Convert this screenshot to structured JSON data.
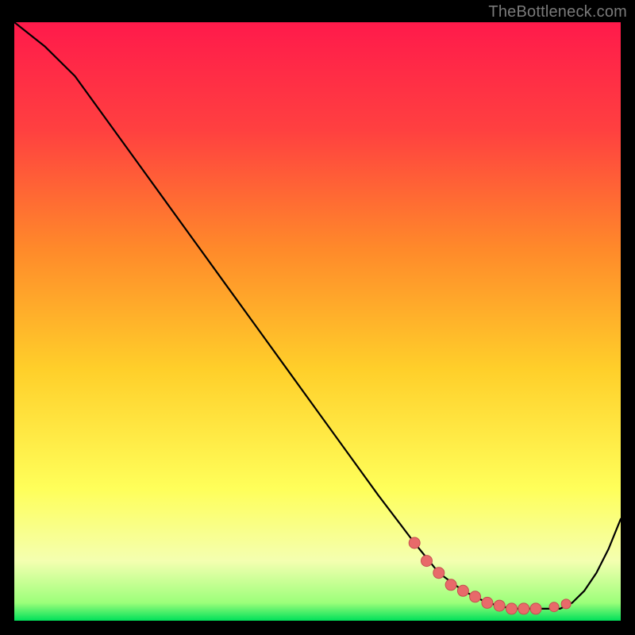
{
  "watermark": "TheBottleneck.com",
  "colors": {
    "bg": "#000000",
    "watermark": "#7a7a7a",
    "line": "#000000",
    "marker_fill": "#e86a6a",
    "marker_stroke": "#c64f50",
    "gradient_stops": [
      {
        "offset": "0%",
        "color": "#ff1a4b"
      },
      {
        "offset": "18%",
        "color": "#ff4040"
      },
      {
        "offset": "38%",
        "color": "#ff8a2a"
      },
      {
        "offset": "58%",
        "color": "#ffcf2a"
      },
      {
        "offset": "78%",
        "color": "#ffff5a"
      },
      {
        "offset": "90%",
        "color": "#f4ffb0"
      },
      {
        "offset": "97%",
        "color": "#9cff7a"
      },
      {
        "offset": "100%",
        "color": "#00e05a"
      }
    ]
  },
  "chart_data": {
    "type": "line",
    "title": "",
    "xlabel": "",
    "ylabel": "",
    "xlim": [
      0,
      100
    ],
    "ylim": [
      0,
      100
    ],
    "grid": false,
    "legend": false,
    "series": [
      {
        "name": "curve",
        "x": [
          0,
          5,
          10,
          15,
          20,
          25,
          30,
          35,
          40,
          45,
          50,
          55,
          60,
          63,
          66,
          70,
          74,
          78,
          82,
          86,
          88,
          90,
          92,
          94,
          96,
          98,
          100
        ],
        "y": [
          100,
          96,
          91,
          84,
          77,
          70,
          63,
          56,
          49,
          42,
          35,
          28,
          21,
          17,
          13,
          8,
          5,
          3,
          2,
          2,
          2,
          2,
          3,
          5,
          8,
          12,
          17
        ]
      }
    ],
    "markers": {
      "name": "bottleneck-zone",
      "x": [
        66,
        68,
        70,
        72,
        74,
        76,
        78,
        80,
        82,
        84,
        86,
        89,
        91
      ],
      "y": [
        13,
        10,
        8,
        6,
        5,
        4,
        3,
        2.5,
        2,
        2,
        2,
        2.3,
        2.8
      ],
      "r": [
        7,
        7,
        7,
        7,
        7,
        7,
        7,
        7,
        7,
        7,
        7,
        6,
        6
      ]
    }
  }
}
